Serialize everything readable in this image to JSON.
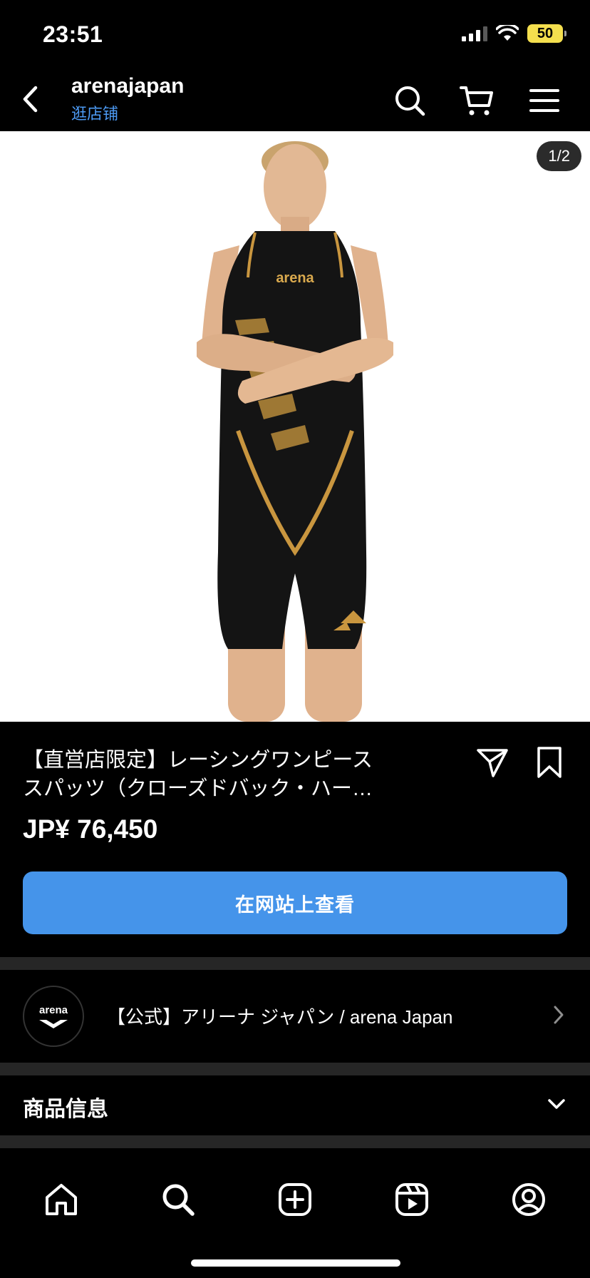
{
  "status_bar": {
    "time": "23:51",
    "battery": "50"
  },
  "header": {
    "shop_name": "arenajapan",
    "shop_link": "逛店铺"
  },
  "gallery": {
    "counter": "1/2",
    "logo_text": "arena"
  },
  "product": {
    "title_line1": "【直営店限定】レーシングワンピース",
    "title_line2": "スパッツ（クローズドバック・ハー…",
    "price": "JP¥ 76,450",
    "view_button": "在网站上查看"
  },
  "seller": {
    "name": "【公式】アリーナ ジャパン / arena Japan",
    "avatar_text": "arena"
  },
  "info_section": {
    "label": "商品信息"
  },
  "colors": {
    "accent": "#4594ea",
    "link": "#4d9bf5",
    "divider": "#262626"
  }
}
